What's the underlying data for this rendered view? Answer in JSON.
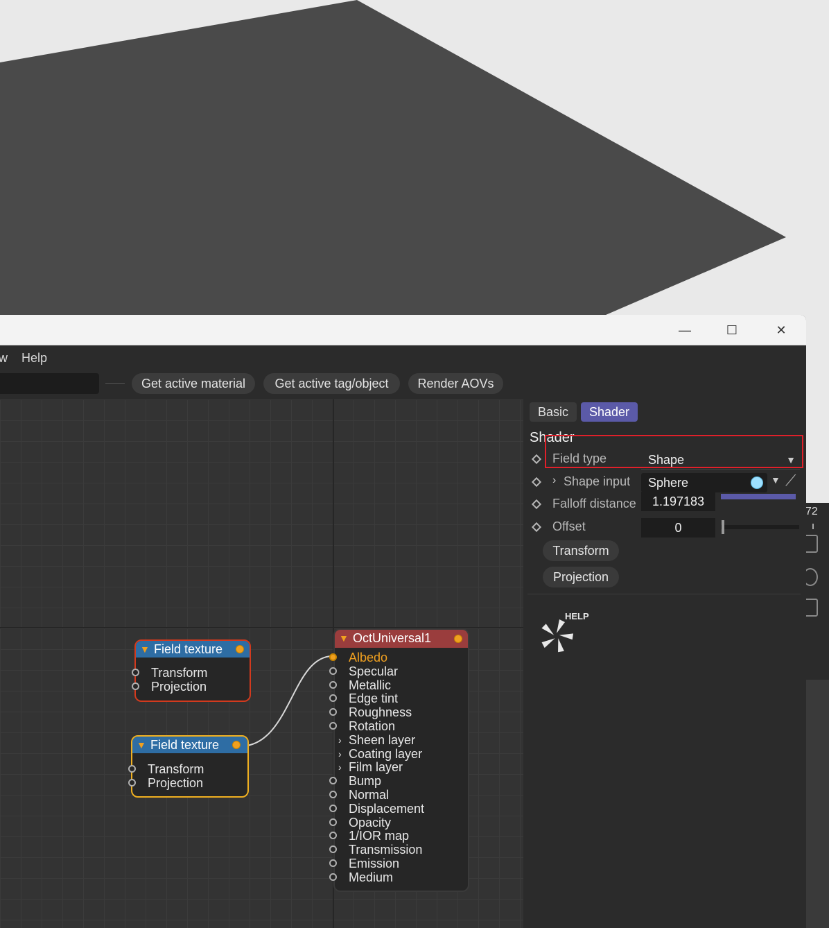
{
  "window": {
    "menu": {
      "partial_item": "w",
      "help": "Help"
    },
    "toolbar": {
      "get_active_material": "Get active material",
      "get_active_tag_object": "Get active tag/object",
      "render_aovs": "Render AOVs"
    },
    "controls": {
      "minimize": "—",
      "maximize": "☐",
      "close": "✕"
    }
  },
  "background_window": {
    "partial_number": "72"
  },
  "node_editor": {
    "nodes": [
      {
        "title": "Field texture",
        "ports": [
          "Transform",
          "Projection"
        ],
        "state": "red-outline"
      },
      {
        "title": "Field texture",
        "ports": [
          "Transform",
          "Projection"
        ],
        "state": "selected-yellow"
      },
      {
        "title": "OctUniversal1",
        "ports": [
          {
            "label": "Albedo",
            "kind": "connected"
          },
          {
            "label": "Specular",
            "kind": "dot"
          },
          {
            "label": "Metallic",
            "kind": "dot"
          },
          {
            "label": "Edge tint",
            "kind": "dot"
          },
          {
            "label": "Roughness",
            "kind": "dot"
          },
          {
            "label": "Rotation",
            "kind": "dot"
          },
          {
            "label": "Sheen layer",
            "kind": "arrow"
          },
          {
            "label": "Coating layer",
            "kind": "arrow"
          },
          {
            "label": "Film layer",
            "kind": "arrow"
          },
          {
            "label": "Bump",
            "kind": "dot"
          },
          {
            "label": "Normal",
            "kind": "dot"
          },
          {
            "label": "Displacement",
            "kind": "dot"
          },
          {
            "label": "Opacity",
            "kind": "dot"
          },
          {
            "label": "1/IOR map",
            "kind": "dot"
          },
          {
            "label": "Transmission",
            "kind": "dot"
          },
          {
            "label": "Emission",
            "kind": "dot"
          },
          {
            "label": "Medium",
            "kind": "dot"
          }
        ]
      }
    ]
  },
  "attributes": {
    "tabs": {
      "basic": "Basic",
      "shader": "Shader"
    },
    "section_title": "Shader",
    "field_type": {
      "label": "Field type",
      "value": "Shape"
    },
    "shape_input": {
      "label": "Shape input",
      "value": "Sphere"
    },
    "falloff_distance": {
      "label": "Falloff distance",
      "value": "1.197183"
    },
    "offset": {
      "label": "Offset",
      "value": "0"
    },
    "transform_button": "Transform",
    "projection_button": "Projection",
    "help_label": "HELP"
  },
  "colors": {
    "accent": "#5b5aa8",
    "node_header": "#2e6da4",
    "octuniversal_header": "#9a3d3d",
    "port_orange": "#f0a020",
    "highlight_red": "#e0202a"
  }
}
